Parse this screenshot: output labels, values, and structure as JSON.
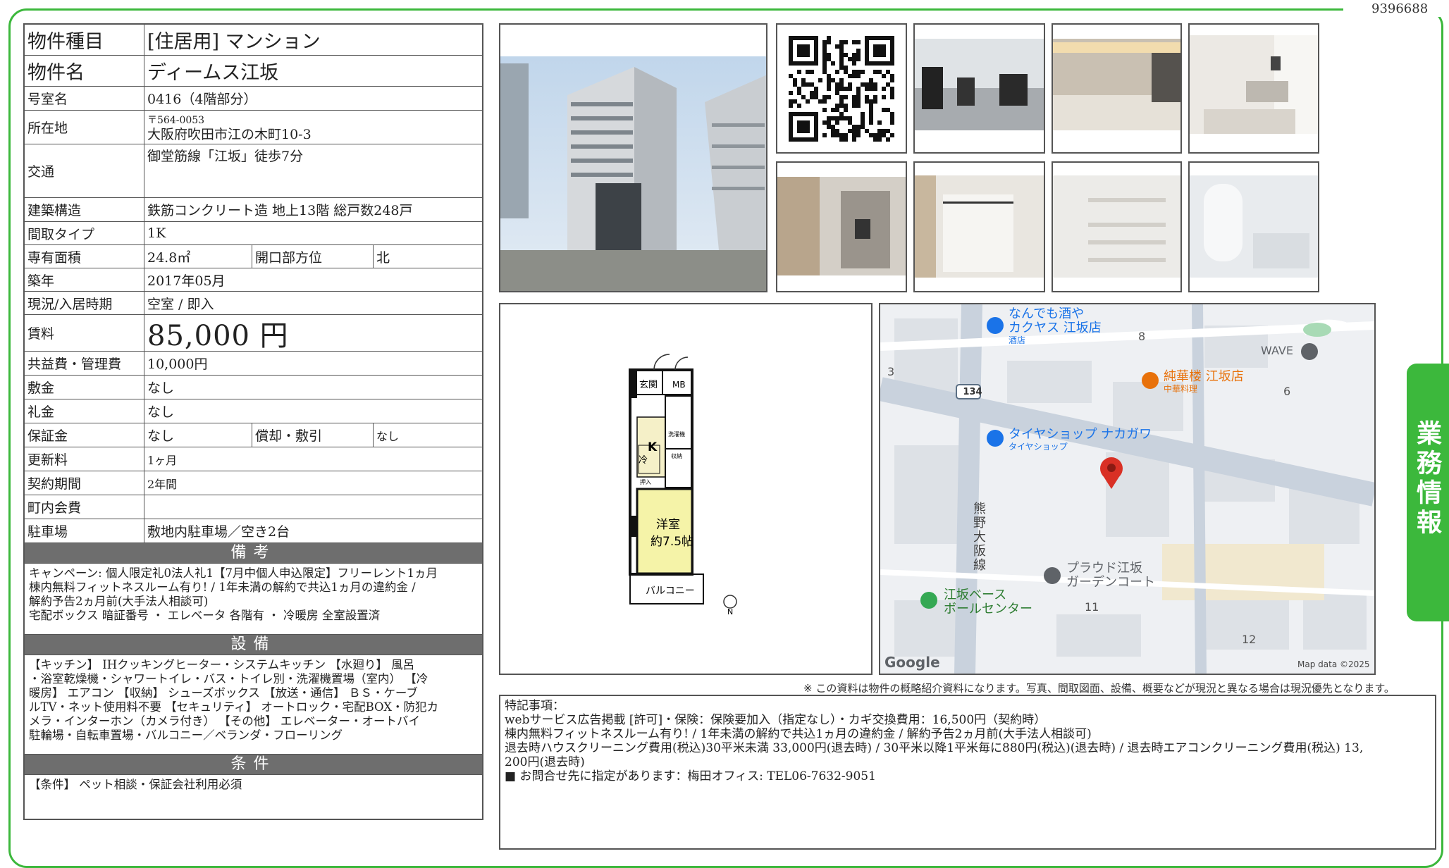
{
  "doc_number": "9396688",
  "property": {
    "type_label": "物件種目",
    "type_value": "[住居用] マンション",
    "name_label": "物件名",
    "name_value": "ディームス江坂",
    "room_label": "号室名",
    "room_value": "0416（4階部分）",
    "address_label": "所在地",
    "zip": "〒564-0053",
    "address": "大阪府吹田市江の木町10-3",
    "transit_label": "交通",
    "transit_value": "御堂筋線「江坂」徒歩7分",
    "structure_label": "建築構造",
    "structure_value": "鉄筋コンクリート造 地上13階 総戸数248戸",
    "layout_label": "間取タイプ",
    "layout_value": "1K",
    "area_label": "専有面積",
    "area_value": "24.8㎡",
    "direction_label": "開口部方位",
    "direction_value": "北",
    "built_label": "築年",
    "built_value": "2017年05月",
    "status_label": "現況/入居時期",
    "status_value": "空室 / 即入",
    "rent_label": "賃料",
    "rent_value": "85,000 円",
    "fee_label": "共益費・管理費",
    "fee_value": "10,000円",
    "deposit_label": "敷金",
    "deposit_value": "なし",
    "key_money_label": "礼金",
    "key_money_value": "なし",
    "guarantee_label": "保証金",
    "guarantee_value": "なし",
    "amort_label": "償却・敷引",
    "amort_value": "なし",
    "renewal_label": "更新料",
    "renewal_value": "1ヶ月",
    "contract_label": "契約期間",
    "contract_value": "2年間",
    "town_fee_label": "町内会費",
    "town_fee_value": "",
    "parking_label": "駐車場",
    "parking_value": "敷地内駐車場／空き2台"
  },
  "sections": {
    "remarks_title": "備考",
    "remarks_text": "キャンペーン: 個人限定礼0法人礼1【7月中個人申込限定】フリーレント1ヵ月\n棟内無料フィットネスルーム有り! / 1年未満の解約で共込1ヵ月の違約金 /\n解約予告2ヵ月前(大手法人相談可)\n宅配ボックス 暗証番号 ・ エレベータ 各階有 ・ 冷暖房 全室設置済",
    "equipment_title": "設備",
    "equipment_text": "【キッチン】 IHクッキングヒーター・システムキッチン 【水廻り】 風呂\n・浴室乾燥機・シャワートイレ・バス・トイレ別・洗濯機置場（室内） 【冷\n暖房】 エアコン 【収納】 シューズボックス 【放送・通信】 ＢＳ・ケーブ\nルTV・ネット使用料不要 【セキュリティ】 オートロック・宅配BOX・防犯カ\nメラ・インターホン（カメラ付き） 【その他】 エレベーター・オートバイ\n駐輪場・自転車置場・バルコニー／ベランダ・フローリング",
    "conditions_title": "条件",
    "conditions_text": "【条件】 ペット相談・保証会社利用必須"
  },
  "floorplan": {
    "entrance": "玄関",
    "mb": "MB",
    "kitchen": "K",
    "fridge": "冷",
    "washer": "洗濯機",
    "closet": "押入",
    "storage": "収納",
    "room_name": "洋室",
    "room_size": "約7.5帖",
    "balcony": "バルコニー",
    "north": "N"
  },
  "map": {
    "poi1_a": "なんでも酒や",
    "poi1_b": "カクヤス 江坂店",
    "poi1_c": "酒店",
    "poi2_a": "純華楼 江坂店",
    "poi2_b": "中華料理",
    "poi3_a": "タイヤショップ ナカガワ",
    "poi3_b": "タイヤショップ",
    "poi4_a": "プラウド江坂",
    "poi4_b": "ガーデンコート",
    "poi5_a": "江坂ベース",
    "poi5_b": "ボールセンター",
    "wave": "WAVE",
    "road_no": "134",
    "road_name": "熊野大阪線",
    "n3": "3",
    "n8": "8",
    "n6": "6",
    "n11": "11",
    "n12": "12",
    "google": "Google",
    "mapdata": "Map data ©2025"
  },
  "disclaimer": "※ この資料は物件の概略紹介資料になります。写真、間取図面、設備、概要などが現況と異なる場合は現況優先となります。",
  "special": {
    "title": "特記事項：",
    "line1": "webサービス広告掲載 [許可]・保険：保険要加入（指定なし）・カギ交換費用：16,500円（契約時）",
    "line2": "棟内無料フィットネスルーム有り! / 1年未満の解約で共込1ヵ月の違約金 / 解約予告2ヵ月前(大手法人相談可)",
    "line3": "退去時ハウスクリーニング費用(税込)30平米未満 33,000円(退去時) / 30平米以降1平米毎に880円(税込)(退去時) / 退去時エアコンクリーニング費用(税込) 13,",
    "line4": "200円(退去時)",
    "line5": "■ お問合せ先に指定があります：梅田オフィス: TEL06-7632-9051"
  },
  "side_tab": "業務情報",
  "colors": {
    "frame": "#3cb83c",
    "band": "#6e6e6e",
    "map_pin": "#d93025",
    "poi_blue": "#1a73e8",
    "poi_orange": "#e8710a"
  }
}
